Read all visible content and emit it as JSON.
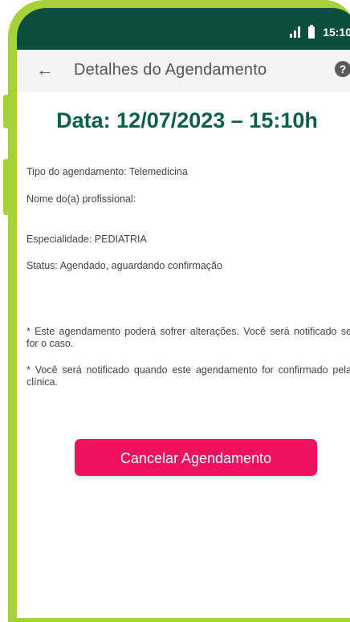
{
  "status_bar": {
    "time": "15:10"
  },
  "app_bar": {
    "back_icon": "arrow-left-icon",
    "title": "Detalhes do Agendamento",
    "help_icon": "question-circle-icon",
    "help_glyph": "?"
  },
  "appointment": {
    "date_heading": "Data: 12/07/2023 – 15:10h",
    "type": "Tipo do agendamento: Telemedicina",
    "professional": "Nome do(a) profissional:",
    "specialty": "Especialidade: PEDIATRIA",
    "status": "Status: Agendado, aguardando confirmação"
  },
  "notes": [
    "* Este agendamento poderá sofrer alterações. Você será notificado se for o caso.",
    "* Você será notificado quando este agendamento for confirmado pela clínica."
  ],
  "actions": {
    "cancel_label": "Cancelar Agendamento"
  },
  "colors": {
    "frame": "#a5d13b",
    "status_bar": "#0d4f3d",
    "heading": "#0d5e47",
    "cancel_button": "#f0125e"
  }
}
